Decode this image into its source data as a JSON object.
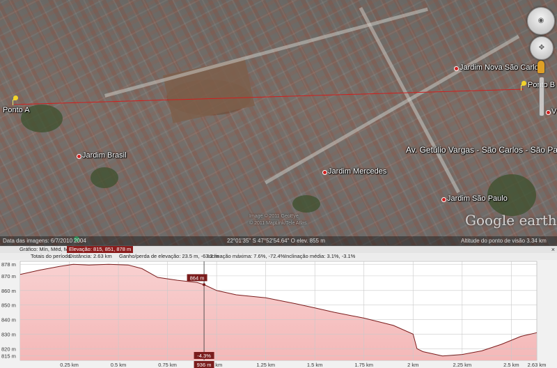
{
  "map": {
    "labels": {
      "point_a": "Ponto A",
      "point_b": "Ponto B",
      "jardim_brasil": "Jardim Brasil",
      "jardim_nova_sao_carlos": "Jardim Nova São Carlos",
      "jardim_mercedes": "Jardim Mercedes",
      "jardim_sao_paulo": "Jardim São Paulo",
      "avenue": "Av. Getúlio Vargas - São Carlos - São Paulo, Br",
      "edge_v": "V"
    },
    "logo": "Google earth",
    "credits": [
      "Image © 2011 GeoEye",
      "© 2011 MapLink/Tele Atlas"
    ],
    "path_color": "#d21e1e"
  },
  "status_bar": {
    "imagery_date": "Data das imagens: 6/7/2010",
    "year": "2004",
    "coordinates": "22°01'35\" S  47°52'54.64\" O  elev. 855 m",
    "eye_altitude": "Altitude do ponto de visão   3.34 km"
  },
  "profile": {
    "header": {
      "graph_label": "Gráfico: Mín, Méd, Máx",
      "elevation": "Elevação: 815, 851, 878 m",
      "totals_label": "Totais do período",
      "distance": "Distância: 2.63 km",
      "gain_loss": "Ganho/perda de elevação: 23.5 m, -63.2 m",
      "max_slope": "Inclinação máxima: 7.6%, -72.4%",
      "avg_slope": "Inclinação média: 3.1%, -3.1%",
      "close": "×"
    },
    "cursor": {
      "elevation_label": "864 m",
      "slope_label": "-4.3%",
      "distance_label": "936 m",
      "distance_km": 0.936,
      "elevation": 864
    },
    "colors": {
      "fill": "#f4b8b8",
      "line": "#7a1c1c",
      "cursor_badge": "#7a1c1c"
    }
  },
  "chart_data": {
    "type": "area",
    "xlabel": "",
    "ylabel": "",
    "xlim": [
      0,
      2.63
    ],
    "ylim": [
      812,
      880
    ],
    "y_ticks": [
      "878 m",
      "870 m",
      "860 m",
      "850 m",
      "840 m",
      "830 m",
      "820 m",
      "815 m"
    ],
    "y_tick_values": [
      878,
      870,
      860,
      850,
      840,
      830,
      820,
      815
    ],
    "x_ticks": [
      "0.25 km",
      "0.5 km",
      "0.75 km",
      "1 km",
      "1.25 km",
      "1.5 km",
      "1.75 km",
      "2 km",
      "2.25 km",
      "2.5 km",
      "2.63 km"
    ],
    "x_tick_values": [
      0.25,
      0.5,
      0.75,
      1.0,
      1.25,
      1.5,
      1.75,
      2.0,
      2.25,
      2.5,
      2.63
    ],
    "series": [
      {
        "x": [
          0,
          0.1,
          0.2,
          0.27,
          0.35,
          0.45,
          0.55,
          0.62,
          0.7,
          0.8,
          0.9,
          0.936,
          1.0,
          1.1,
          1.25,
          1.4,
          1.5,
          1.6,
          1.75,
          1.9,
          2.0,
          2.02,
          2.05,
          2.15,
          2.25,
          2.35,
          2.45,
          2.55,
          2.63
        ],
        "y": [
          871,
          874,
          876.5,
          878,
          877.5,
          878,
          877.5,
          875,
          869,
          867,
          865.5,
          864,
          860,
          857,
          855,
          851,
          848,
          845,
          841,
          836,
          830,
          820,
          818,
          815,
          816,
          818.5,
          823,
          828.5,
          831
        ]
      }
    ],
    "grid": true
  }
}
